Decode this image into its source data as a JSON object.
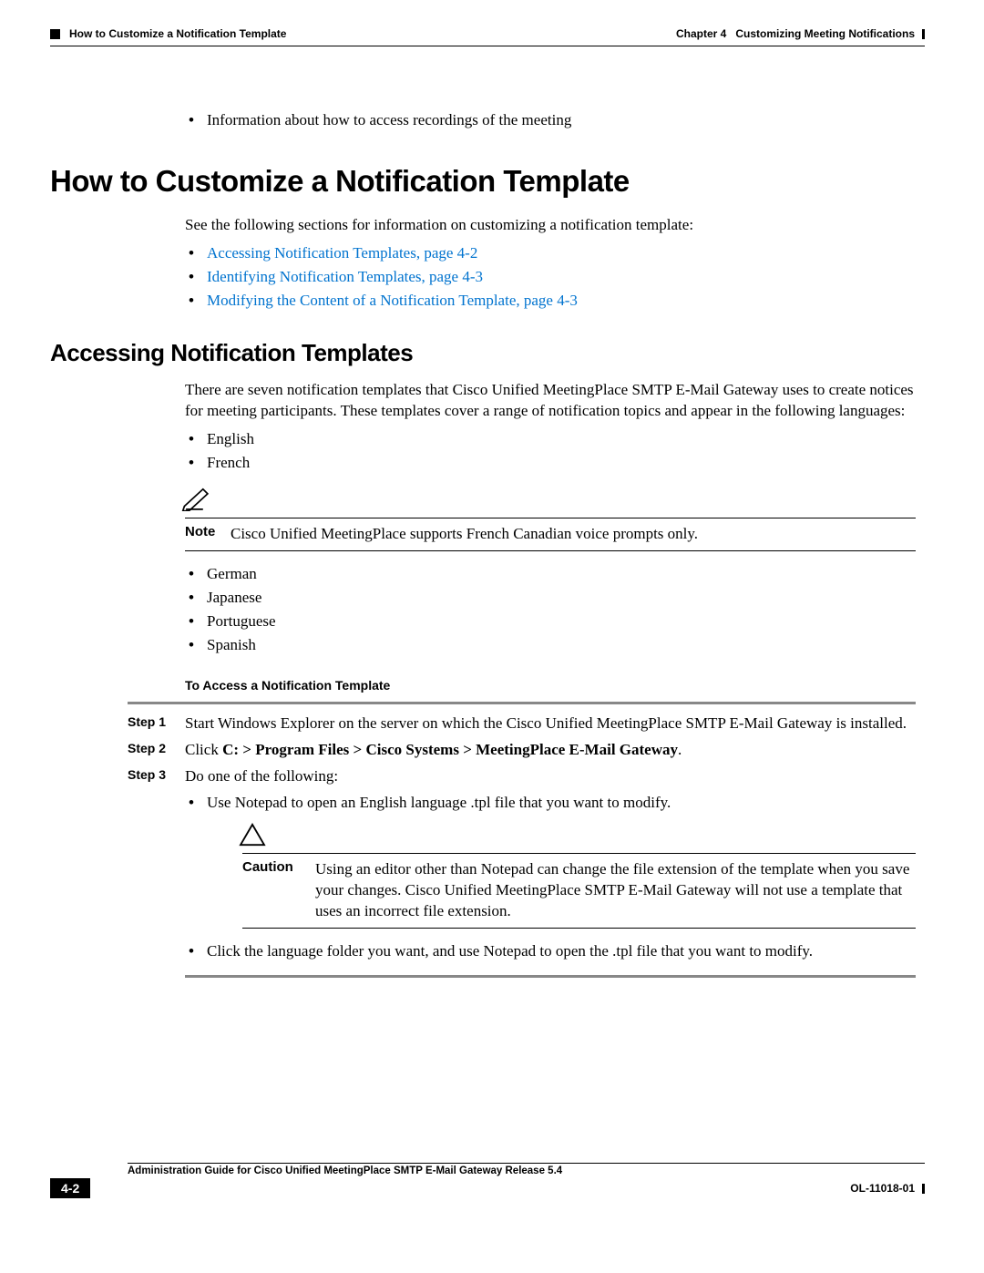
{
  "header": {
    "left": "How to Customize a Notification Template",
    "right_chapter": "Chapter 4",
    "right_title": "Customizing Meeting Notifications"
  },
  "top_bullet": "Information about how to access recordings of the meeting",
  "h1": "How to Customize a Notification Template",
  "intro1": "See the following sections for information on customizing a notification template:",
  "xrefs": [
    "Accessing Notification Templates, page 4-2",
    "Identifying Notification Templates, page 4-3",
    "Modifying the Content of a Notification Template, page 4-3"
  ],
  "h2": "Accessing Notification Templates",
  "p2": "There are seven notification templates that Cisco Unified MeetingPlace SMTP E-Mail Gateway uses to create notices for meeting participants. These templates cover a range of notification topics and appear in the following languages:",
  "langs1": [
    "English",
    "French"
  ],
  "note": {
    "label": "Note",
    "text": "Cisco Unified MeetingPlace supports French Canadian voice prompts only."
  },
  "langs2": [
    "German",
    "Japanese",
    "Portuguese",
    "Spanish"
  ],
  "subhead": "To Access a Notification Template",
  "steps": {
    "s1_label": "Step 1",
    "s1_text": "Start Windows Explorer on the server on which the Cisco Unified MeetingPlace SMTP E-Mail Gateway is installed.",
    "s2_label": "Step 2",
    "s2_pre": "Click ",
    "s2_bold": "C: > Program Files > Cisco Systems > MeetingPlace E-Mail Gateway",
    "s2_post": ".",
    "s3_label": "Step 3",
    "s3_text": "Do one of the following:",
    "s3_b1": "Use Notepad to open an English language .tpl file that you want to modify.",
    "s3_b2": "Click the language folder you want, and use Notepad to open the .tpl file that you want to modify."
  },
  "caution": {
    "label": "Caution",
    "text": "Using an editor other than Notepad can change the file extension of the template when you save your changes. Cisco Unified MeetingPlace SMTP E-Mail Gateway will not use a template that uses an incorrect file extension."
  },
  "footer": {
    "title": "Administration Guide for Cisco Unified MeetingPlace SMTP E-Mail Gateway Release 5.4",
    "page": "4-2",
    "docid": "OL-11018-01"
  }
}
